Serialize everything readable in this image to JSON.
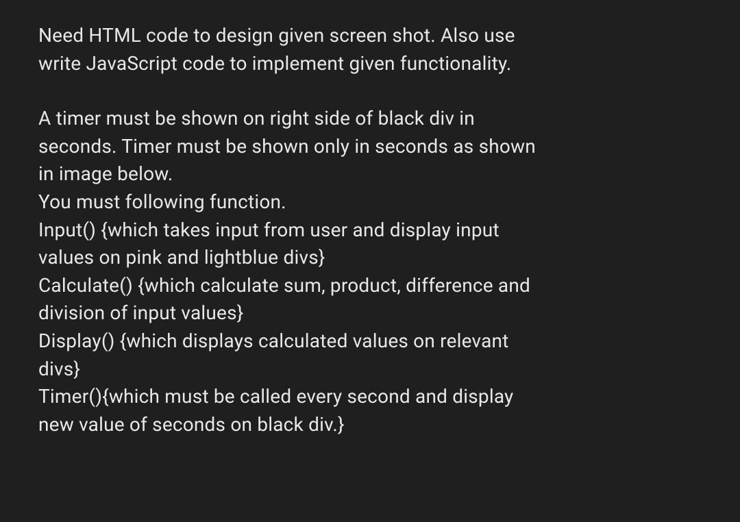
{
  "para1": {
    "line1": "Need HTML code to design given screen shot. Also use",
    "line2": "write JavaScript code to implement given functionality."
  },
  "para2": {
    "line1": "A timer must be shown on right side of black div in",
    "line2": "seconds. Timer must be shown only in seconds as shown",
    "line3": "in image below.",
    "line4": "You must following function.",
    "line5": "Input() {which takes input from user and display input",
    "line6": "values on pink and lightblue divs}",
    "line7": "Calculate() {which calculate sum, product, difference and",
    "line8": "division of input values}",
    "line9": "Display() {which displays calculated values on relevant",
    "line10": "divs}",
    "line11": "Timer(){which must be called every second and display",
    "line12": "new value of seconds on black div.}"
  }
}
